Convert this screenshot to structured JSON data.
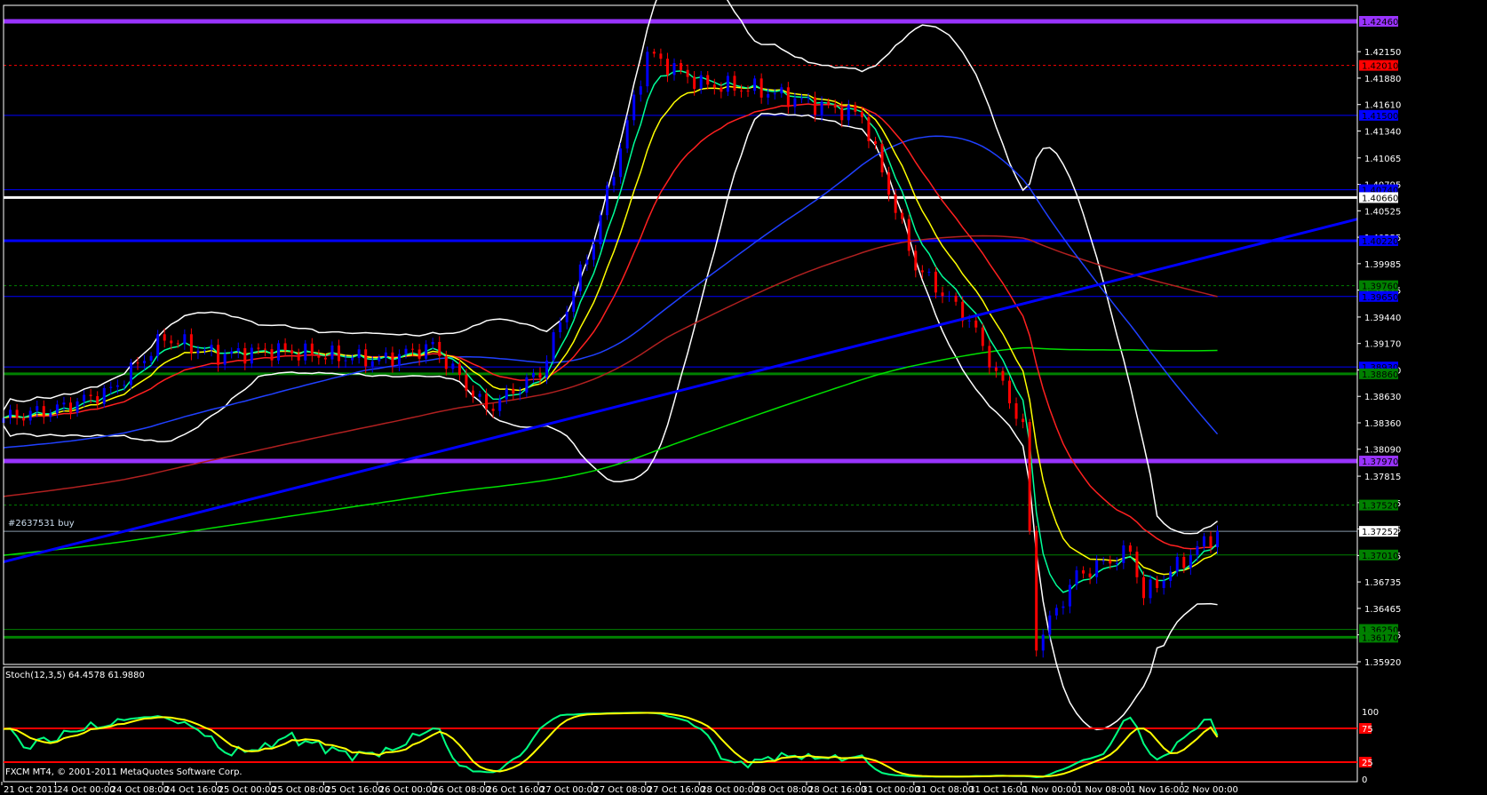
{
  "window": {
    "stoch_label": "Stoch(12,3,5) 64.4578 61.9880",
    "copyright": "FXCM MT4, © 2001-2011 MetaQuotes Software Corp.",
    "order_label": "#2637531 buy"
  },
  "colors": {
    "background": "#000000",
    "bull_candle": "#0000ff",
    "bear_candle": "#ff0000",
    "ema_fast": "#00ff99",
    "ema_mid": "#ffff00",
    "ema_slow": "#ff2020",
    "ma_blue": "#2040ff",
    "ma_darkred": "#b02020",
    "ma_green": "#00e000",
    "bollinger": "#ffffff",
    "stoch_main": "#00ff80",
    "stoch_signal": "#ffff00"
  },
  "chart_data": {
    "type": "candlestick",
    "timeframe_note": "",
    "x_tick_labels": [
      "21 Oct 2011",
      "24 Oct 00:00",
      "24 Oct 08:00",
      "24 Oct 16:00",
      "25 Oct 00:00",
      "25 Oct 08:00",
      "25 Oct 16:00",
      "26 Oct 00:00",
      "26 Oct 08:00",
      "26 Oct 16:00",
      "27 Oct 00:00",
      "27 Oct 08:00",
      "27 Oct 16:00",
      "28 Oct 00:00",
      "28 Oct 08:00",
      "28 Oct 16:00",
      "31 Oct 00:00",
      "31 Oct 08:00",
      "31 Oct 16:00",
      "1 Nov 00:00",
      "1 Nov 08:00",
      "1 Nov 16:00",
      "2 Nov 00:00"
    ],
    "y_tick_labels": [
      "1.42150",
      "1.41880",
      "1.41610",
      "1.41340",
      "1.41065",
      "1.40795",
      "1.40525",
      "1.40255",
      "1.39985",
      "1.39715",
      "1.39440",
      "1.39170",
      "1.38900",
      "1.38630",
      "1.38360",
      "1.38090",
      "1.37815",
      "1.37545",
      "1.37275",
      "1.37005",
      "1.36735",
      "1.36465",
      "1.36195",
      "1.35920"
    ],
    "ylim": [
      1.3592,
      1.4262
    ],
    "approx_close": [
      {
        "t": "21 Oct 2011",
        "p": 1.3841
      },
      {
        "t": "24 Oct 00:00",
        "p": 1.385
      },
      {
        "t": "24 Oct 08:00",
        "p": 1.3869
      },
      {
        "t": "24 Oct 16:00",
        "p": 1.3923
      },
      {
        "t": "25 Oct 00:00",
        "p": 1.3905
      },
      {
        "t": "25 Oct 08:00",
        "p": 1.391
      },
      {
        "t": "25 Oct 16:00",
        "p": 1.3905
      },
      {
        "t": "26 Oct 00:00",
        "p": 1.39
      },
      {
        "t": "26 Oct 08:00",
        "p": 1.3914
      },
      {
        "t": "26 Oct 16:00",
        "p": 1.385
      },
      {
        "t": "27 Oct 00:00",
        "p": 1.3887
      },
      {
        "t": "27 Oct 08:00",
        "p": 1.4023
      },
      {
        "t": "27 Oct 16:00",
        "p": 1.4213
      },
      {
        "t": "28 Oct 00:00",
        "p": 1.4182
      },
      {
        "t": "28 Oct 08:00",
        "p": 1.4177
      },
      {
        "t": "28 Oct 16:00",
        "p": 1.4163
      },
      {
        "t": "31 Oct 00:00",
        "p": 1.415
      },
      {
        "t": "31 Oct 08:00",
        "p": 1.3996
      },
      {
        "t": "31 Oct 16:00",
        "p": 1.3941
      },
      {
        "t": "1 Nov 00:00",
        "p": 1.3832
      },
      {
        "t": "1 Nov 08:00",
        "p": 1.368
      },
      {
        "t": "1 Nov 16:00",
        "p": 1.3705
      },
      {
        "t": "2 Nov 00:00",
        "p": 1.3696
      }
    ],
    "last_price": 1.37252,
    "price_levels": [
      {
        "price": 1.4246,
        "label": "1.42460",
        "color": "#9933ff",
        "style": "thick"
      },
      {
        "price": 1.4201,
        "label": "1.42010",
        "color": "#ff0000",
        "style": "dashed"
      },
      {
        "price": 1.415,
        "label": "1.41500",
        "color": "#0000ff",
        "style": "thin"
      },
      {
        "price": 1.4074,
        "label": "1.40740",
        "color": "#0000ff",
        "style": "thin"
      },
      {
        "price": 1.4066,
        "label": "1.40660",
        "color": "#ffffff",
        "style": "thick"
      },
      {
        "price": 1.4022,
        "label": "1.40220",
        "color": "#0000ff",
        "style": "thick"
      },
      {
        "price": 1.3976,
        "label": "1.39760",
        "color": "#008000",
        "style": "dashed"
      },
      {
        "price": 1.3965,
        "label": "1.39650",
        "color": "#0000ff",
        "style": "thin"
      },
      {
        "price": 1.3893,
        "label": "1.38930",
        "color": "#0000ff",
        "style": "thin"
      },
      {
        "price": 1.3886,
        "label": "1.38860",
        "color": "#008000",
        "style": "thick"
      },
      {
        "price": 1.3797,
        "label": "1.37970",
        "color": "#9933ff",
        "style": "thick"
      },
      {
        "price": 1.3752,
        "label": "1.37520",
        "color": "#008000",
        "style": "dashed"
      },
      {
        "price": 1.37252,
        "label": "1.37252",
        "color": "#8899aa",
        "style": "bid"
      },
      {
        "price": 1.3701,
        "label": "1.37010",
        "color": "#008000",
        "style": "thin"
      },
      {
        "price": 1.3625,
        "label": "1.36250",
        "color": "#008000",
        "style": "thin"
      },
      {
        "price": 1.3617,
        "label": "1.36170",
        "color": "#008000",
        "style": "thick"
      }
    ],
    "trendline": {
      "start_price": 1.3694,
      "end_price": 1.4044,
      "color": "#0000ff"
    },
    "stochastic": {
      "params": "12,3,5",
      "main": 64.4578,
      "signal": 61.988,
      "levels": [
        75,
        25
      ],
      "level_labels": [
        "100",
        "75",
        "25",
        "0"
      ],
      "range": [
        0,
        100
      ]
    }
  }
}
